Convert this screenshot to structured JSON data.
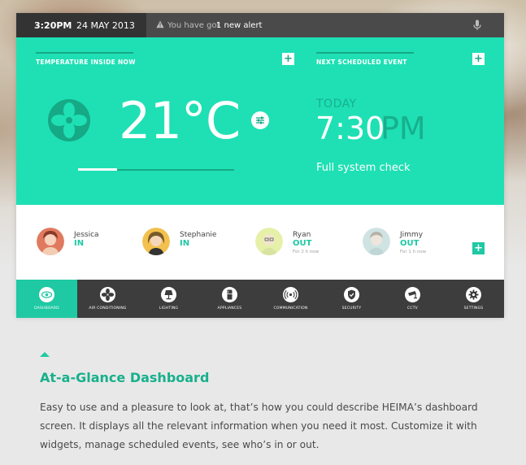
{
  "status_bar": {
    "time": "3:20PM",
    "date": "24 MAY 2013",
    "alert_prefix": "You have got",
    "alert_strong": "1 new alert",
    "warning_icon": "warning-icon",
    "mic_icon": "microphone-icon"
  },
  "temperature": {
    "title": "TEMPERATURE INSIDE NOW",
    "value": "21°C",
    "fan_icon": "fan-icon",
    "adjust_icon": "sliders-icon",
    "level": 0.25
  },
  "event": {
    "title": "NEXT SCHEDULED EVENT",
    "day": "TODAY",
    "time": "7:30",
    "ampm": "PM",
    "name": "Full system check"
  },
  "people": [
    {
      "name": "Jessica",
      "status": "IN",
      "sub": ""
    },
    {
      "name": "Stephanie",
      "status": "IN",
      "sub": ""
    },
    {
      "name": "Ryan",
      "status": "OUT",
      "sub": "For 2 h now"
    },
    {
      "name": "Jimmy",
      "status": "OUT",
      "sub": "For 1 h now"
    }
  ],
  "nav": [
    {
      "label": "DASHBOARD",
      "icon": "eye-icon",
      "active": true
    },
    {
      "label": "AIR CONDITIONING",
      "icon": "fan-icon",
      "active": false
    },
    {
      "label": "LIGHTING",
      "icon": "lamp-icon",
      "active": false
    },
    {
      "label": "APPLIANCES",
      "icon": "fridge-icon",
      "active": false
    },
    {
      "label": "COMMUNICATION",
      "icon": "signal-icon",
      "active": false
    },
    {
      "label": "SECURITY",
      "icon": "shield-icon",
      "active": false
    },
    {
      "label": "CCTV",
      "icon": "camera-icon",
      "active": false
    },
    {
      "label": "SETTINGS",
      "icon": "gear-icon",
      "active": false
    }
  ],
  "article": {
    "title": "At-a-Glance Dashboard",
    "body": "Easy to use and a pleasure to look at, that’s how you could describe HEIMA’s dashboard screen. It displays all the relevant information when you need it most. Customize it with widgets, manage scheduled events, see who’s in or out."
  },
  "colors": {
    "teal": "#1ee0b4",
    "teal_dark": "#16a986",
    "dark": "#3d3d3d"
  }
}
